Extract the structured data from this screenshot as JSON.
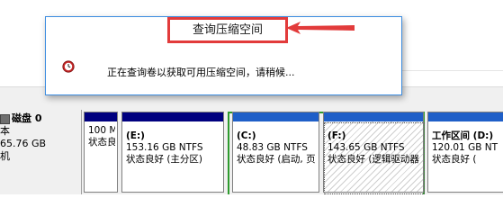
{
  "dialog": {
    "title": "查询压缩空间",
    "message": "正在查询卷以获取可用压缩空间，请稍候..."
  },
  "disk": {
    "title": "磁盘 0",
    "type_partial": "本",
    "size_partial": "65.76 GB",
    "status_partial": "机"
  },
  "partitions": [
    {
      "name": "",
      "size": "100 M",
      "status": "状态良"
    },
    {
      "name": "(E:)",
      "size": "153.16 GB NTFS",
      "status": "状态良好 (主分区)"
    },
    {
      "name": "(C:)",
      "size": "48.83 GB NTFS",
      "status": "状态良好 (启动, 页"
    },
    {
      "name": "(F:)",
      "size": "143.65 GB NTFS",
      "status": "状态良好 (逻辑驱动器"
    },
    {
      "name": "工作区间  (D:)",
      "size": "120.01 GB NT",
      "status": "状态良好 ("
    }
  ],
  "colors": {
    "accent_red": "#e23b3b",
    "primary_bar": "#00007f",
    "logical_bar": "#1f5fc8",
    "extended_frame": "#2e9b2e"
  },
  "icons": {
    "disk": "disk-icon",
    "clock": "clock-icon",
    "arrow": "arrow-icon"
  }
}
